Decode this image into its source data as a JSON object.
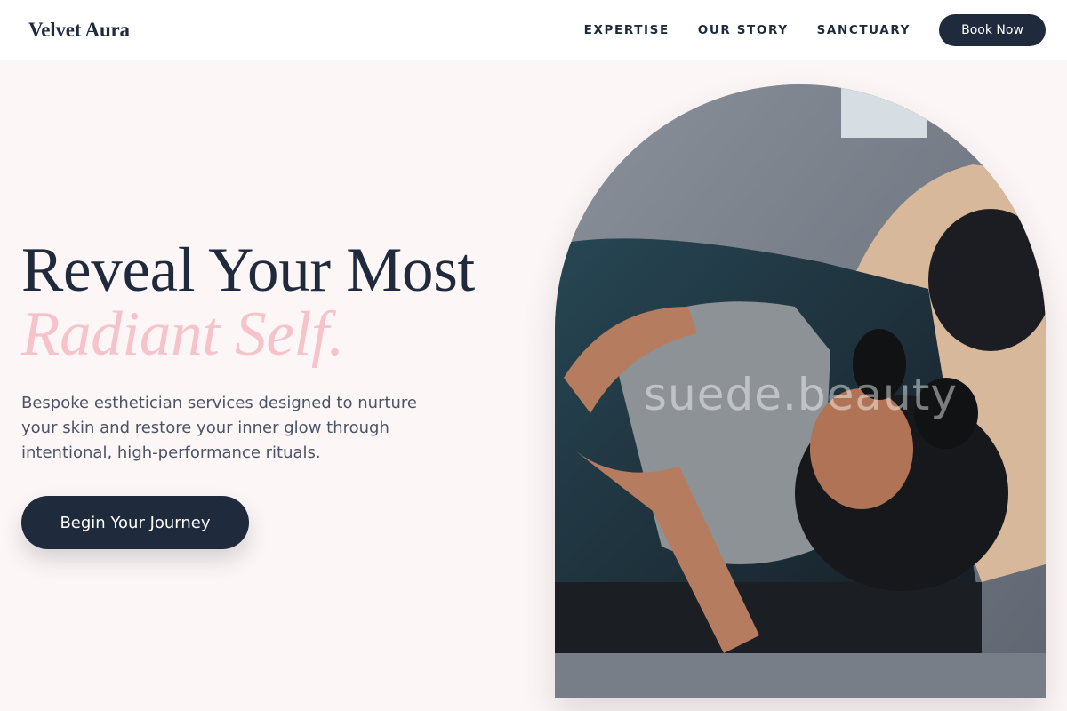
{
  "brand": {
    "name": "Velvet Aura"
  },
  "nav": {
    "links": [
      "EXPERTISE",
      "OUR STORY",
      "SANCTUARY"
    ],
    "cta": "Book Now"
  },
  "hero": {
    "headline_line1": "Reveal Your Most",
    "headline_line2": "Radiant Self.",
    "description": "Bespoke esthetician services designed to nurture your skin and restore your inner glow through intentional, high-performance rituals.",
    "cta": "Begin Your Journey",
    "image_watermark": "suede.beauty"
  },
  "colors": {
    "primary": "#1f2a3d",
    "accent_pink": "#f6c3cb",
    "background": "#fdf6f6"
  }
}
